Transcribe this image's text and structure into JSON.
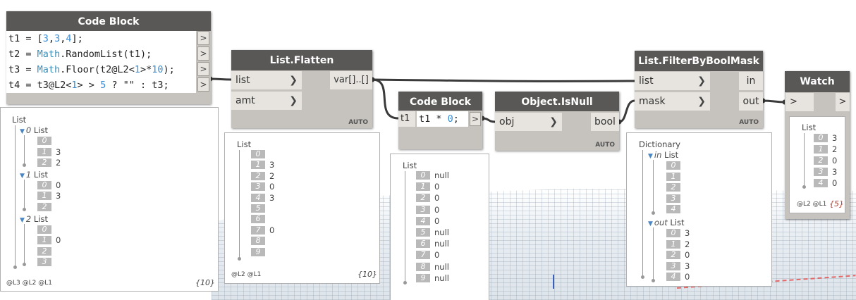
{
  "nodes": {
    "code_block_1": {
      "title": "Code Block",
      "lines": [
        [
          [
            "t1 = [",
            ""
          ],
          [
            "3",
            "n"
          ],
          [
            ",",
            ""
          ],
          [
            "3",
            "n"
          ],
          [
            ",",
            ""
          ],
          [
            "4",
            "n"
          ],
          [
            "];",
            ""
          ]
        ],
        [
          [
            "t2 = ",
            ""
          ],
          [
            "Math",
            "k"
          ],
          [
            ".RandomList(t1);",
            ""
          ]
        ],
        [
          [
            "t3 = ",
            ""
          ],
          [
            "Math",
            "k"
          ],
          [
            ".Floor(t2@L2<",
            ""
          ],
          [
            "1",
            "n"
          ],
          [
            ">*",
            ""
          ],
          [
            "10",
            "n"
          ],
          [
            ");",
            ""
          ]
        ],
        [
          [
            "t4 = t3@L2<",
            ""
          ],
          [
            "1",
            "n"
          ],
          [
            "> > ",
            ""
          ],
          [
            "5",
            "n"
          ],
          [
            " ? \"\" : t3;",
            ""
          ]
        ]
      ],
      "output_arrow": ">"
    },
    "list_flatten": {
      "title": "List.Flatten",
      "inputs": [
        "list",
        "amt"
      ],
      "output": "var[]..[]",
      "lacing": "AUTO"
    },
    "code_block_2": {
      "title": "Code Block",
      "input": "t1",
      "code": [
        [
          "t1 * ",
          ""
        ],
        [
          "0",
          "n"
        ],
        [
          ";",
          ""
        ]
      ],
      "output_arrow": ">"
    },
    "object_isnull": {
      "title": "Object.IsNull",
      "input": "obj",
      "output": "bool",
      "lacing": "AUTO"
    },
    "filter_bool_mask": {
      "title": "List.FilterByBoolMask",
      "inputs": [
        "list",
        "mask"
      ],
      "outputs": [
        "in",
        "out"
      ],
      "lacing": "AUTO"
    },
    "watch": {
      "title": "Watch",
      "input_arrow": ">",
      "output_arrow": ">"
    }
  },
  "previews": {
    "code_block_1": {
      "root": "List",
      "groups": [
        {
          "index": "0",
          "label": "List",
          "items": [
            [
              "0",
              ""
            ],
            [
              "1",
              "3"
            ],
            [
              "2",
              "2"
            ]
          ]
        },
        {
          "index": "1",
          "label": "List",
          "items": [
            [
              "0",
              "0"
            ],
            [
              "1",
              "3"
            ],
            [
              "2",
              ""
            ]
          ]
        },
        {
          "index": "2",
          "label": "List",
          "items": [
            [
              "0",
              ""
            ],
            [
              "1",
              "0"
            ],
            [
              "2",
              ""
            ],
            [
              "3",
              ""
            ]
          ]
        }
      ],
      "levels": "@L3 @L2 @L1",
      "count": "{10}"
    },
    "list_flatten": {
      "root": "List",
      "items": [
        [
          "0",
          ""
        ],
        [
          "1",
          "3"
        ],
        [
          "2",
          "2"
        ],
        [
          "3",
          "0"
        ],
        [
          "4",
          "3"
        ],
        [
          "5",
          ""
        ],
        [
          "6",
          ""
        ],
        [
          "7",
          "0"
        ],
        [
          "8",
          ""
        ],
        [
          "9",
          ""
        ]
      ],
      "levels": "@L2 @L1",
      "count": "{10}"
    },
    "code_block_2": {
      "root": "List",
      "items": [
        [
          "0",
          "null"
        ],
        [
          "1",
          "0"
        ],
        [
          "2",
          "0"
        ],
        [
          "3",
          "0"
        ],
        [
          "4",
          "0"
        ],
        [
          "5",
          "null"
        ],
        [
          "6",
          "null"
        ],
        [
          "7",
          "0"
        ],
        [
          "8",
          "null"
        ],
        [
          "9",
          "null"
        ]
      ],
      "levels": "@L2 @L1",
      "count": "{10}"
    },
    "filter_bool_mask": {
      "root": "Dictionary",
      "groups": [
        {
          "key": "in",
          "label": "List",
          "items": [
            [
              "0",
              ""
            ],
            [
              "1",
              ""
            ],
            [
              "2",
              ""
            ],
            [
              "3",
              ""
            ],
            [
              "4",
              ""
            ]
          ]
        },
        {
          "key": "out",
          "label": "List",
          "items": [
            [
              "0",
              "3"
            ],
            [
              "1",
              "2"
            ],
            [
              "2",
              "0"
            ],
            [
              "3",
              "3"
            ],
            [
              "4",
              "0"
            ]
          ]
        }
      ]
    },
    "watch": {
      "root": "List",
      "items": [
        [
          "0",
          "3"
        ],
        [
          "1",
          "2"
        ],
        [
          "2",
          "0"
        ],
        [
          "3",
          "3"
        ],
        [
          "4",
          "0"
        ]
      ],
      "levels": "@L2 @L1",
      "count": "{5}"
    }
  },
  "colors": {
    "node_header": "#595856",
    "node_body": "#c6c2bd",
    "port_bg": "#e7e4df",
    "wire": "#3a3a3a",
    "number": "#3b8cd0",
    "watch_count": "#b03a2e"
  }
}
